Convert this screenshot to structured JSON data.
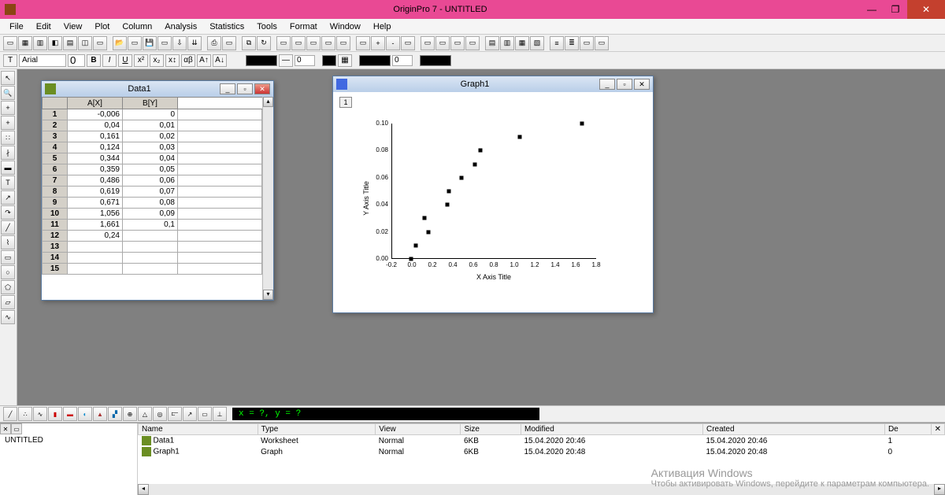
{
  "chart_data": {
    "type": "scatter",
    "title": "",
    "xlabel": "X Axis Title",
    "ylabel": "Y Axis Title",
    "xlim": [
      -0.2,
      1.8
    ],
    "ylim": [
      0.0,
      0.1
    ],
    "x_ticks": [
      "-0.2",
      "0.0",
      "0.2",
      "0.4",
      "0.6",
      "0.8",
      "1.0",
      "1.2",
      "1.4",
      "1.6",
      "1.8"
    ],
    "y_ticks": [
      "0.00",
      "0.02",
      "0.04",
      "0.06",
      "0.08",
      "0.10"
    ],
    "series": [
      {
        "name": "B(Y)",
        "x": [
          -0.006,
          0.04,
          0.161,
          0.124,
          0.344,
          0.359,
          0.486,
          0.619,
          0.671,
          1.056,
          1.661
        ],
        "y": [
          0.0,
          0.01,
          0.02,
          0.03,
          0.04,
          0.05,
          0.06,
          0.07,
          0.08,
          0.09,
          0.1
        ]
      }
    ]
  },
  "app": {
    "title": "OriginPro 7 - UNTITLED"
  },
  "menu": [
    "File",
    "Edit",
    "View",
    "Plot",
    "Column",
    "Analysis",
    "Statistics",
    "Tools",
    "Format",
    "Window",
    "Help"
  ],
  "font": {
    "name": "Arial",
    "size": "0"
  },
  "linewidth1": "0",
  "linewidth2": "0",
  "data_window": {
    "title": "Data1",
    "cols": [
      "A[X]",
      "B[Y]"
    ],
    "rows": [
      {
        "n": "1",
        "a": "-0,006",
        "b": "0"
      },
      {
        "n": "2",
        "a": "0,04",
        "b": "0,01"
      },
      {
        "n": "3",
        "a": "0,161",
        "b": "0,02"
      },
      {
        "n": "4",
        "a": "0,124",
        "b": "0,03"
      },
      {
        "n": "5",
        "a": "0,344",
        "b": "0,04"
      },
      {
        "n": "6",
        "a": "0,359",
        "b": "0,05"
      },
      {
        "n": "7",
        "a": "0,486",
        "b": "0,06"
      },
      {
        "n": "8",
        "a": "0,619",
        "b": "0,07"
      },
      {
        "n": "9",
        "a": "0,671",
        "b": "0,08"
      },
      {
        "n": "10",
        "a": "1,056",
        "b": "0,09"
      },
      {
        "n": "11",
        "a": "1,661",
        "b": "0,1"
      },
      {
        "n": "12",
        "a": "0,24",
        "b": ""
      },
      {
        "n": "13",
        "a": "",
        "b": ""
      },
      {
        "n": "14",
        "a": "",
        "b": ""
      },
      {
        "n": "15",
        "a": "",
        "b": ""
      }
    ]
  },
  "graph_window": {
    "title": "Graph1",
    "layer": "1"
  },
  "coord": "x = ?, y = ?",
  "explorer": {
    "project": "UNTITLED",
    "headers": [
      "Name",
      "Type",
      "View",
      "Size",
      "Modified",
      "Created",
      "De"
    ],
    "rows": [
      {
        "name": "Data1",
        "type": "Worksheet",
        "view": "Normal",
        "size": "6KB",
        "mod": "15.04.2020 20:46",
        "cre": "15.04.2020 20:46",
        "de": "1"
      },
      {
        "name": "Graph1",
        "type": "Graph",
        "view": "Normal",
        "size": "6KB",
        "mod": "15.04.2020 20:48",
        "cre": "15.04.2020 20:48",
        "de": "0"
      }
    ]
  },
  "watermark": {
    "t1": "Активация Windows",
    "t2": "Чтобы активировать Windows, перейдите к параметрам компьютера."
  }
}
